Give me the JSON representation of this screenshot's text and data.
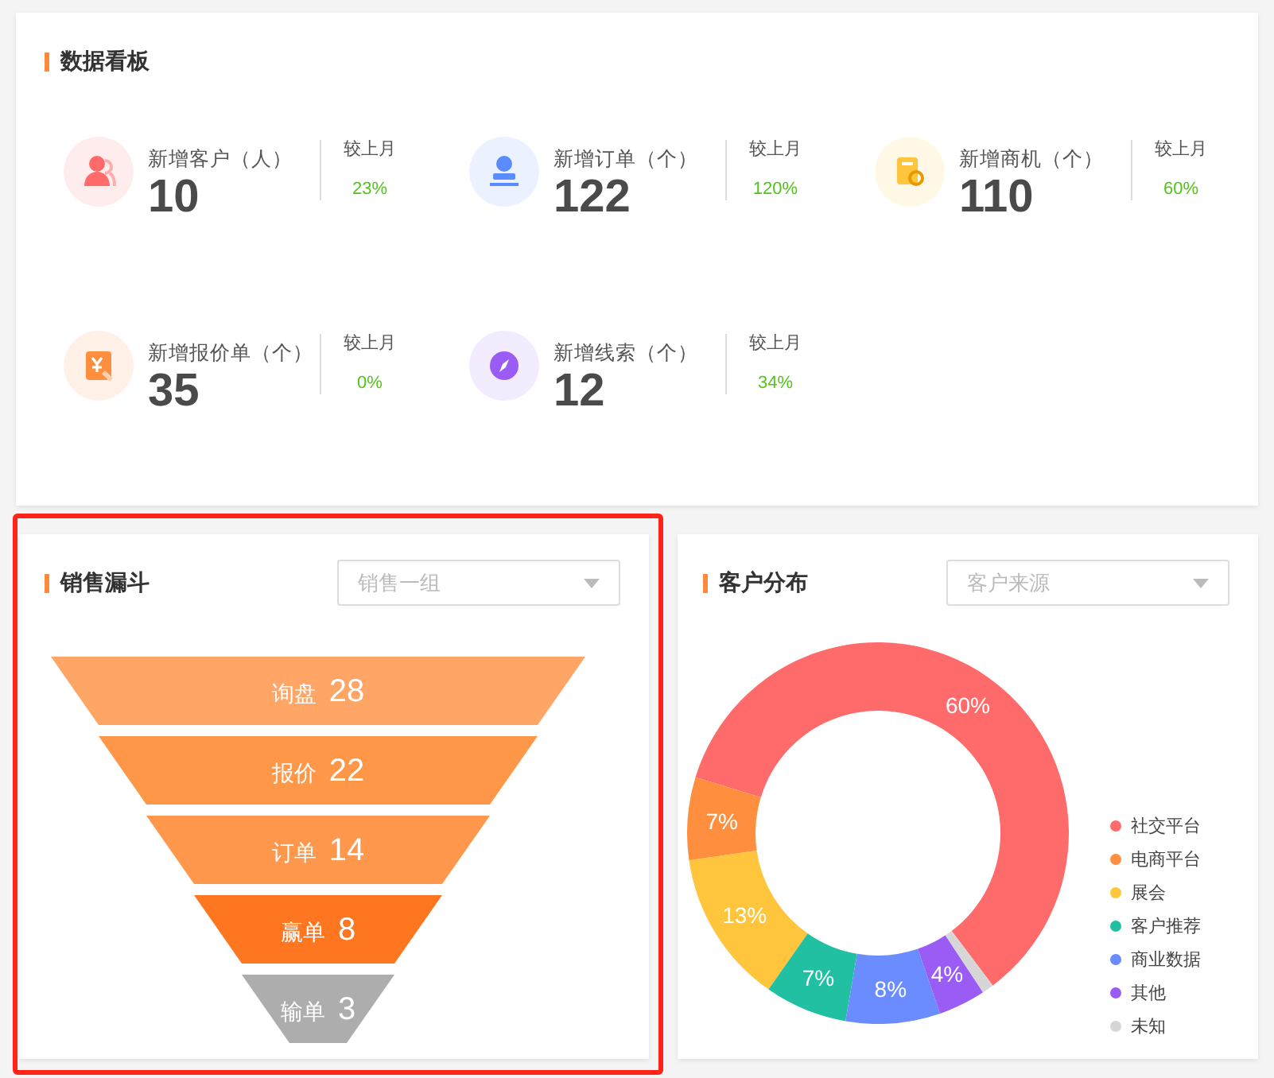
{
  "dashboard": {
    "title": "数据看板",
    "stats": [
      {
        "kind": "customer",
        "label": "新增客户（人）",
        "value": "10",
        "compare_label": "较上月",
        "change": "23%",
        "color": "#ff6b6b"
      },
      {
        "kind": "order",
        "label": "新增订单（个）",
        "value": "122",
        "compare_label": "较上月",
        "change": "120%",
        "color": "#5b8cff"
      },
      {
        "kind": "opportunity",
        "label": "新增商机（个）",
        "value": "110",
        "compare_label": "较上月",
        "change": "60%",
        "color": "#ffc53d"
      },
      {
        "kind": "quote",
        "label": "新增报价单（个）",
        "value": "35",
        "compare_label": "较上月",
        "change": "0%",
        "color": "#ff8f3f"
      },
      {
        "kind": "lead",
        "label": "新增线索（个）",
        "value": "12",
        "compare_label": "较上月",
        "change": "34%",
        "color": "#9b5cf6"
      }
    ]
  },
  "sales_funnel": {
    "title": "销售漏斗",
    "highlighted": true,
    "select": {
      "placeholder": "销售一组"
    },
    "stages": [
      {
        "label": "询盘",
        "value": "28",
        "color": "#ffa566"
      },
      {
        "label": "报价",
        "value": "22",
        "color": "#ff9749"
      },
      {
        "label": "订单",
        "value": "14",
        "color": "#ff984c"
      },
      {
        "label": "赢单",
        "value": "8",
        "color": "#ff7620"
      },
      {
        "label": "输单",
        "value": "3",
        "color": "#adadad"
      }
    ]
  },
  "customer_distribution": {
    "title": "客户分布",
    "select": {
      "placeholder": "客户来源"
    },
    "chart_data": {
      "type": "donut",
      "categories": [
        "社交平台",
        "电商平台",
        "展会",
        "客户推荐",
        "商业数据",
        "其他",
        "未知"
      ],
      "series": [
        {
          "values": [
            60,
            7,
            13,
            7,
            8,
            4,
            1
          ]
        }
      ],
      "colors": [
        "#ff6b6b",
        "#ff8f3f",
        "#ffc53d",
        "#22c0a3",
        "#6b8cff",
        "#9b5cf6",
        "#d6d6d6"
      ],
      "value_labels": [
        "60%",
        "7%",
        "13%",
        "7%",
        "8%",
        "4%",
        null
      ]
    }
  }
}
